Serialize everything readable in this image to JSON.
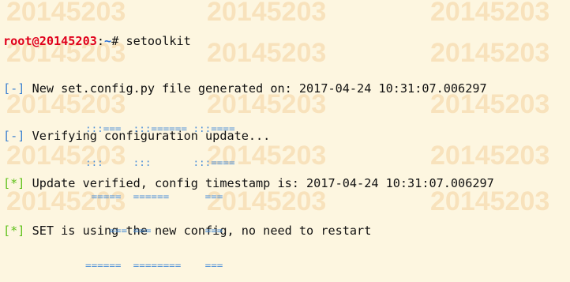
{
  "terminal": {
    "prompt": {
      "user": "root@20145203",
      "separator": ":",
      "path": "~",
      "symbol": "# ",
      "command": "setoolkit"
    },
    "lines": [
      {
        "tag": "[-]",
        "text": " New set.config.py file generated on: 2017-04-24 10:31:07.006297"
      },
      {
        "tag": "[-]",
        "text": " Verifying configuration update..."
      },
      {
        "tag": "[*]",
        "text": " Update verified, config timestamp is: 2017-04-24 10:31:07.006297"
      },
      {
        "tag": "[*]",
        "text": " SET is using the new config, no need to restart"
      }
    ],
    "banner": [
      ":::===  :::====== :::====",
      ":::     :::       :::====",
      " =====  ======      ===",
      "    === ===         ===",
      "======  ========    ==="
    ]
  },
  "watermark": {
    "text": "20145203"
  },
  "colors": {
    "background": "#fdf6e0",
    "prompt_user": "#e0001b",
    "prompt_path": "#2a6fd6",
    "tag_info": "#3a7fd0",
    "tag_ok": "#5fc11a",
    "banner": "#4a8ed8",
    "watermark": "#e89c3c"
  }
}
